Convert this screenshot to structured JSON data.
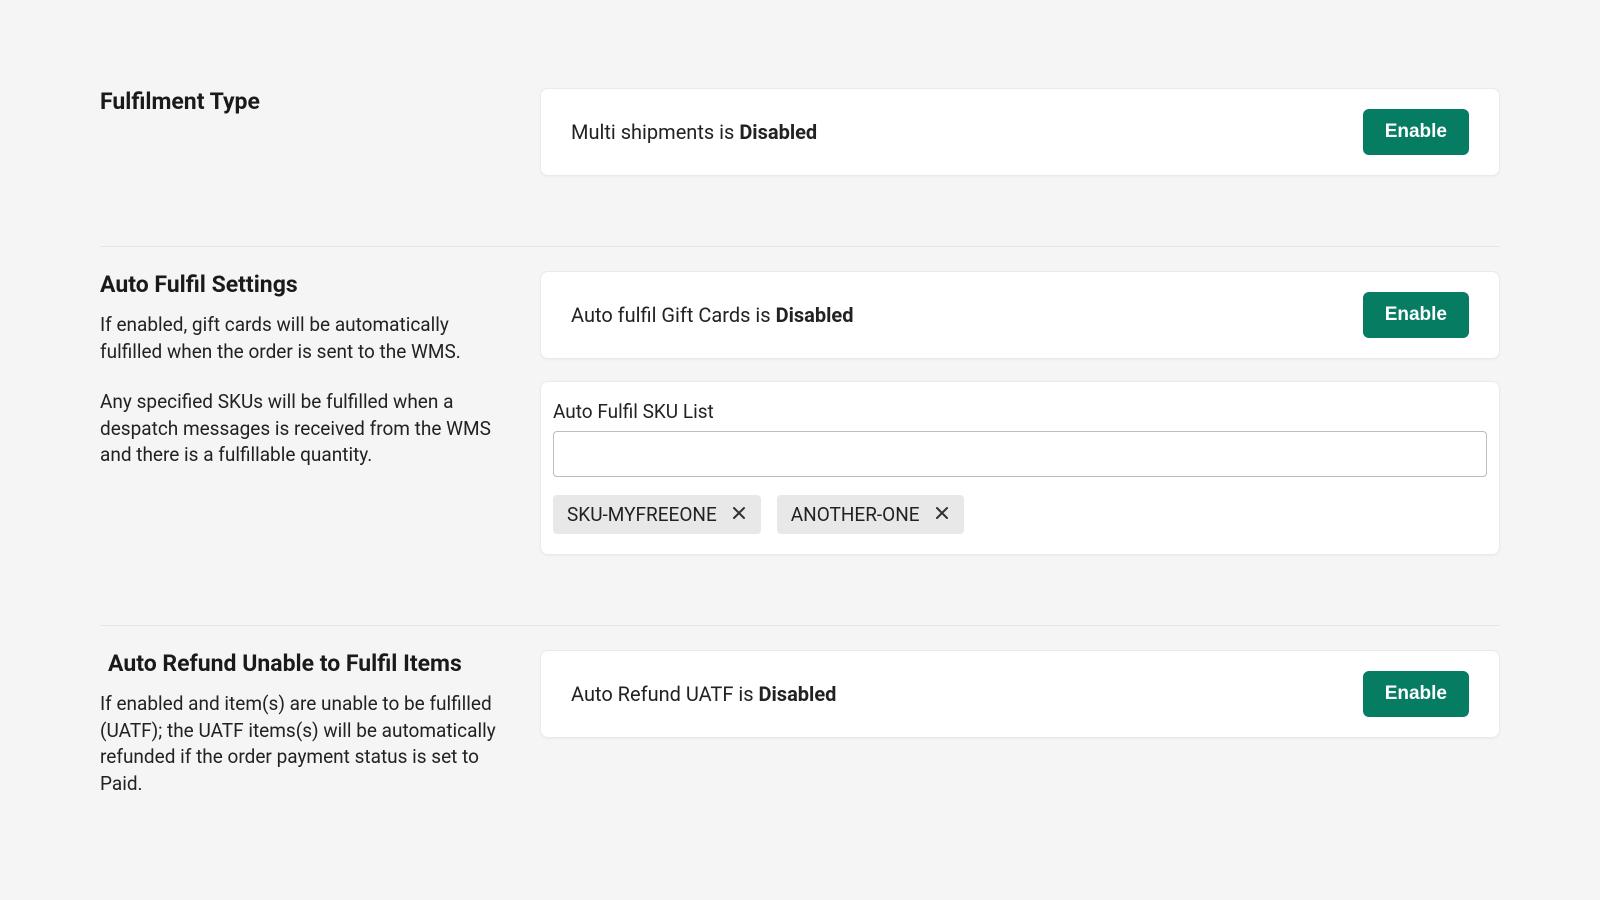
{
  "colors": {
    "accent": "#067d63"
  },
  "sections": {
    "fulfilment": {
      "title": "Fulfilment Type",
      "status_prefix": "Multi shipments is ",
      "status_value": "Disabled",
      "button": "Enable"
    },
    "auto_fulfil": {
      "title": "Auto Fulfil Settings",
      "desc_p1": "If enabled, gift cards will be automatically fulfilled when the order is sent to the WMS.",
      "desc_p2": "Any specified SKUs will be fulfilled when a despatch messages is received from the WMS and there is a fulfillable quantity.",
      "gift_status_prefix": "Auto fulfil Gift Cards is ",
      "gift_status_value": "Disabled",
      "gift_button": "Enable",
      "sku_label": "Auto Fulfil SKU List",
      "sku_input_value": "",
      "sku_tags": [
        "SKU-MYFREEONE",
        "ANOTHER-ONE"
      ]
    },
    "auto_refund": {
      "title": "Auto Refund Unable to Fulfil Items",
      "desc": "If enabled and item(s) are unable to be fulfilled (UATF); the UATF items(s) will be automatically refunded if the order payment status is set to Paid.",
      "status_prefix": "Auto Refund UATF is ",
      "status_value": "Disabled",
      "button": "Enable"
    }
  }
}
